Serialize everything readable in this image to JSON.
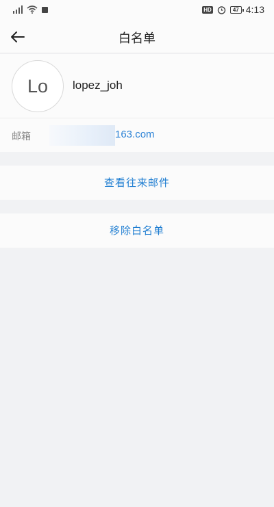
{
  "status_bar": {
    "left_icons": [
      "signal-icon",
      "wifi-icon",
      "notification-icon"
    ],
    "hd_badge": "HD",
    "battery_level": "47",
    "time": "4:13"
  },
  "header": {
    "back_icon": "arrow-left-icon",
    "title": "白名单"
  },
  "contact": {
    "avatar_text": "Lo",
    "name": "lopez_joh",
    "email_label": "邮箱",
    "email_domain": "163.com"
  },
  "actions": {
    "view_mail": "查看往来邮件",
    "remove_whitelist": "移除白名单"
  },
  "colors": {
    "accent": "#1e7dd1",
    "background": "#f1f2f4",
    "surface": "#fbfbfb"
  }
}
